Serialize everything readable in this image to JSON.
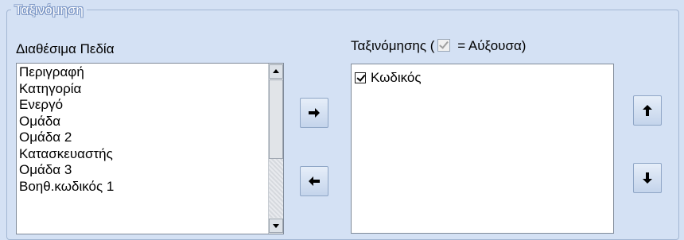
{
  "group": {
    "title": "Ταξινόμηση"
  },
  "available": {
    "label": "Διαθέσιμα Πεδία",
    "items": [
      "Περιγραφή",
      "Κατηγορία",
      "Ενεργό",
      "Ομάδα",
      "Ομάδα 2",
      "Κατασκευαστής",
      "Ομάδα 3",
      "Βοηθ.κωδικός 1"
    ]
  },
  "sort": {
    "label_prefix": "Ταξινόμησης (",
    "label_suffix": " = Αύξουσα)",
    "items": [
      {
        "label": "Κωδικός",
        "checked": true
      }
    ]
  },
  "icons": {
    "move_right": "arrow-right-icon",
    "move_left": "arrow-left-icon",
    "move_up": "arrow-up-icon",
    "move_down": "arrow-down-icon"
  }
}
